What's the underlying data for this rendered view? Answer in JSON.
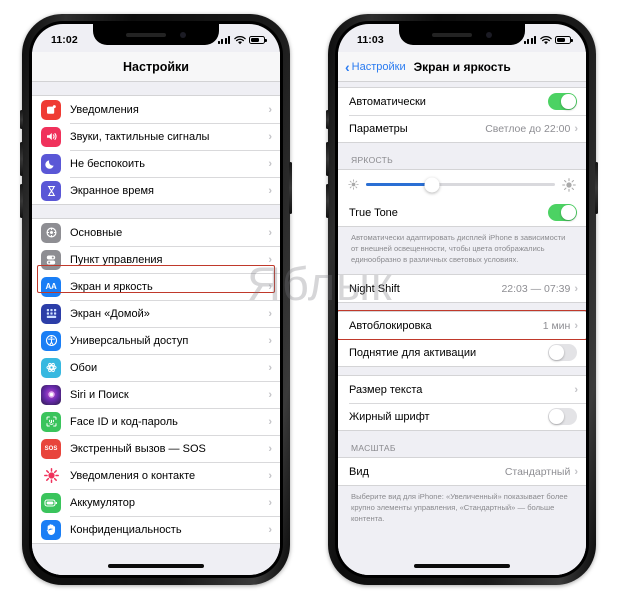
{
  "left_phone": {
    "status_bar": {
      "time": "11:02",
      "signal_icon": "cellular-bars-icon",
      "wifi_icon": "wifi-icon",
      "battery_icon": "battery-icon"
    },
    "nav": {
      "title": "Настройки"
    },
    "groups": [
      {
        "rows": [
          {
            "label": "Уведомления",
            "icon": "notifications-icon",
            "icon_color": "#ef3b33",
            "glyph": "▣",
            "chevron": "›"
          },
          {
            "label": "Звуки, тактильные сигналы",
            "icon": "sounds-icon",
            "icon_color": "#f0315b",
            "glyph": "◀",
            "chevron": "›"
          },
          {
            "label": "Не беспокоить",
            "icon": "do-not-disturb-icon",
            "icon_color": "#5a57d6",
            "glyph": "☾",
            "chevron": "›"
          },
          {
            "label": "Экранное время",
            "icon": "screen-time-icon",
            "icon_color": "#5a57d6",
            "glyph": "⧗",
            "chevron": "›"
          }
        ]
      },
      {
        "rows": [
          {
            "label": "Основные",
            "icon": "general-gear-icon",
            "icon_color": "#8e8e93",
            "glyph": "⚙",
            "chevron": "›"
          },
          {
            "label": "Пункт управления",
            "icon": "control-center-icon",
            "icon_color": "#8e8e93",
            "glyph": "⧉",
            "chevron": "›"
          },
          {
            "label": "Экран и яркость",
            "icon": "display-brightness-icon",
            "icon_color": "#1a7ef5",
            "glyph": "AA",
            "chevron": "›",
            "highlighted": true
          },
          {
            "label": "Экран «Домой»",
            "icon": "home-screen-icon",
            "icon_color": "#2c3ea8",
            "glyph": "▦",
            "chevron": "›"
          },
          {
            "label": "Универсальный доступ",
            "icon": "accessibility-icon",
            "icon_color": "#1a7ef5",
            "glyph": "⚇",
            "chevron": "›"
          },
          {
            "label": "Обои",
            "icon": "wallpaper-icon",
            "icon_color": "#37b8e0",
            "glyph": "✾",
            "chevron": "›"
          },
          {
            "label": "Siri и Поиск",
            "icon": "siri-icon",
            "icon_color": "#2b1b46",
            "glyph": "◉",
            "chevron": "›"
          },
          {
            "label": "Face ID и код-пароль",
            "icon": "face-id-icon",
            "icon_color": "#3ac45c",
            "glyph": "☺",
            "chevron": "›"
          },
          {
            "label": "Экстренный вызов — SOS",
            "icon": "sos-icon",
            "icon_color": "#e8453c",
            "glyph": "SOS",
            "chevron": "›"
          },
          {
            "label": "Уведомления о контакте",
            "icon": "contact-notifications-icon",
            "icon_color": "#f0315b",
            "glyph": "✺",
            "chevron": "›"
          },
          {
            "label": "Аккумулятор",
            "icon": "battery-settings-icon",
            "icon_color": "#3ac45c",
            "glyph": "▭",
            "chevron": "›"
          },
          {
            "label": "Конфиденциальность",
            "icon": "privacy-hand-icon",
            "icon_color": "#1a7ef5",
            "glyph": "✋",
            "chevron": "›"
          }
        ]
      }
    ]
  },
  "right_phone": {
    "status_bar": {
      "time": "11:03",
      "signal_icon": "cellular-bars-icon",
      "wifi_icon": "wifi-icon",
      "battery_icon": "battery-icon"
    },
    "nav": {
      "back_label": "Настройки",
      "back_chevron": "‹",
      "title": "Экран и яркость"
    },
    "appearance_group": {
      "rows": [
        {
          "label": "Автоматически",
          "control": "toggle",
          "state": "on"
        },
        {
          "label": "Параметры",
          "value": "Светлое до 22:00",
          "chevron": "›"
        }
      ]
    },
    "brightness_section": {
      "header": "ЯРКОСТЬ",
      "slider": {
        "name": "brightness-slider",
        "value": 35,
        "min_icon": "sun-small-icon",
        "max_icon": "sun-large-icon"
      },
      "true_tone": {
        "label": "True Tone",
        "control": "toggle",
        "state": "on"
      },
      "footnote": "Автоматически адаптировать дисплей iPhone в зависимости от внешней освещенности, чтобы цвета отображались единообразно в различных световых условиях."
    },
    "night_shift": {
      "label": "Night Shift",
      "value": "22:03 — 07:39",
      "chevron": "›"
    },
    "lock_group": {
      "rows": [
        {
          "label": "Автоблокировка",
          "value": "1 мин",
          "chevron": "›",
          "highlighted": true
        },
        {
          "label": "Поднятие для активации",
          "control": "toggle",
          "state": "off"
        }
      ]
    },
    "text_group": {
      "rows": [
        {
          "label": "Размер текста",
          "chevron": "›"
        },
        {
          "label": "Жирный шрифт",
          "control": "toggle",
          "state": "off"
        }
      ]
    },
    "zoom_section": {
      "header": "МАСШТАБ",
      "row": {
        "label": "Вид",
        "value": "Стандартный",
        "chevron": "›"
      },
      "footnote": "Выберите вид для iPhone: «Увеличенный» показывает более крупно элементы управления, «Стандартный» — больше контента."
    }
  },
  "watermark": {
    "text": "Яблык"
  },
  "colors": {
    "accent_blue": "#2a7bf0",
    "toggle_green": "#4cd263",
    "slider_blue": "#2a6fd4",
    "highlight_red": "#c0392b"
  }
}
